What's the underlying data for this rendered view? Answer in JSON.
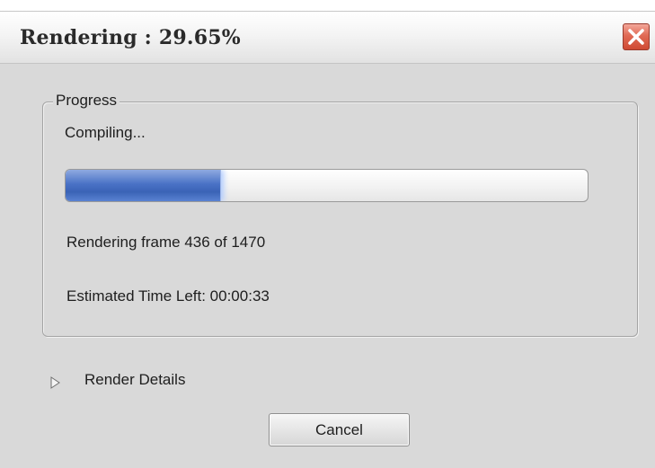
{
  "window": {
    "title": "Rendering : 29.65%",
    "close_icon": "close-icon"
  },
  "progress_group": {
    "label": "Progress",
    "status": "Compiling...",
    "progress_fraction": 0.2965,
    "frame_text": "Rendering frame 436 of 1470",
    "estimated_time": "Estimated Time Left: 00:00:33"
  },
  "details": {
    "icon": "triangle-right-icon",
    "label": "Render Details"
  },
  "buttons": {
    "cancel_label": "Cancel"
  },
  "colors": {
    "progress_fill": "#4a72c6",
    "close_button": "#d9553f"
  }
}
